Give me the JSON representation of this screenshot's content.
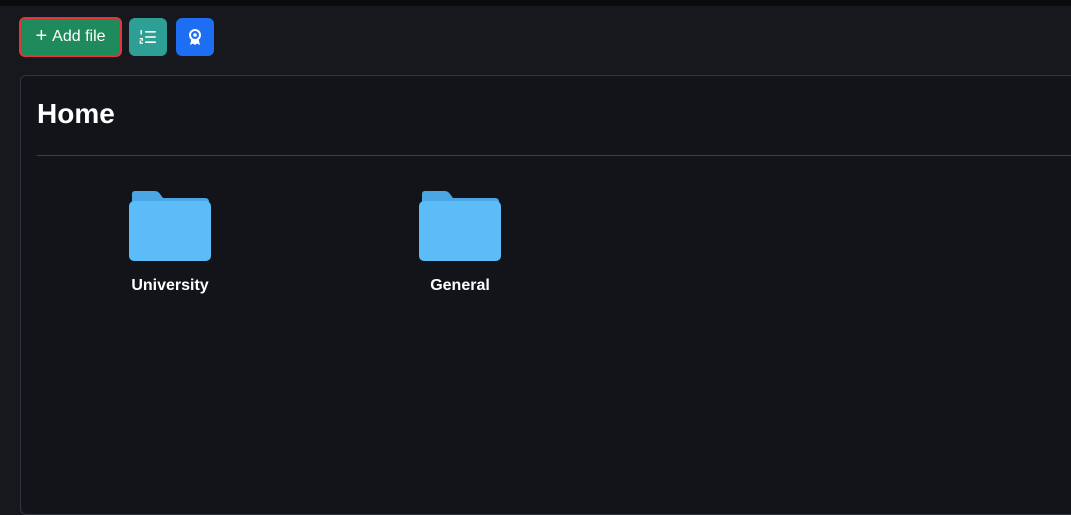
{
  "toolbar": {
    "add_file_label": "Add file",
    "add_icon": "plus-icon",
    "list_icon": "numbered-list-icon",
    "badge_icon": "award-badge-icon"
  },
  "panel": {
    "title": "Home"
  },
  "folders": [
    {
      "name": "University",
      "icon": "folder-icon"
    },
    {
      "name": "General",
      "icon": "folder-icon"
    }
  ],
  "colors": {
    "background": "#16181d",
    "panel": "#121419",
    "add_button": "#1f8a5b",
    "add_button_border": "#e0353a",
    "list_button": "#2e9f94",
    "badge_button": "#1d6ef2",
    "folder": "#5bbcf7"
  }
}
